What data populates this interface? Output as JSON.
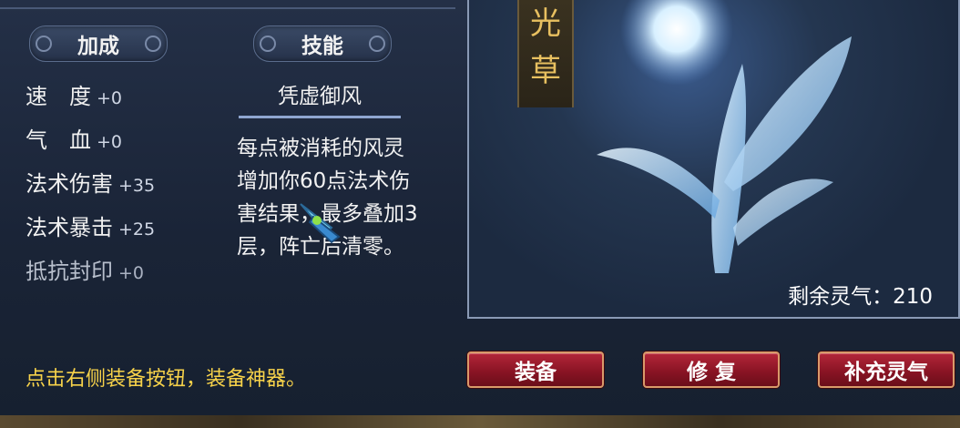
{
  "tabs": {
    "bonus_label": "加成",
    "skill_label": "技能"
  },
  "attributes": [
    {
      "name": "速　度",
      "value": "+0"
    },
    {
      "name": "气　血",
      "value": "+0"
    },
    {
      "name": "法术伤害",
      "value": "+35"
    },
    {
      "name": "法术暴击",
      "value": "+25"
    },
    {
      "name": "抵抗封印",
      "value": "+0"
    }
  ],
  "skill": {
    "name": "凭虚御风",
    "description": "每点被消耗的风灵增加你60点法术伤害结果，最多叠加3层，阵亡后清零。"
  },
  "hint": "点击右侧装备按钮，装备神器。",
  "artifact": {
    "name": "光草",
    "remaining_label": "剩余灵气：",
    "remaining_value": "210"
  },
  "buttons": {
    "equip": "装备",
    "repair": "修 复",
    "replenish": "补充灵气"
  },
  "colors": {
    "hint": "#f7d24a",
    "button": "#a51d30",
    "name": "#e8c060"
  },
  "icons": {
    "cursor": "feather-cursor-icon"
  }
}
